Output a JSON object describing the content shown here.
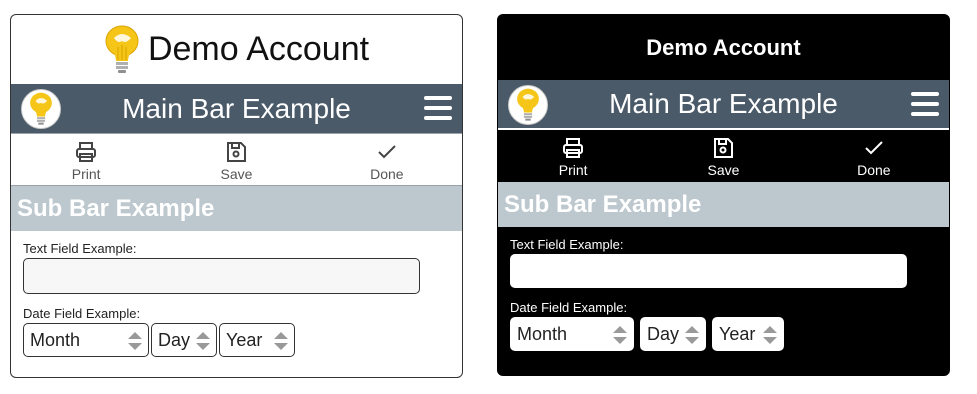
{
  "colors": {
    "mainbar": "#4a5a69",
    "subbar": "#bcc7ce",
    "bulb": "#f5c518",
    "dark_background": "#000000"
  },
  "panels": [
    {
      "theme": "light",
      "header_title": "Demo Account",
      "mainbar_title": "Main Bar Example",
      "toolbar": [
        {
          "label": "Print",
          "icon": "printer-icon"
        },
        {
          "label": "Save",
          "icon": "floppy-disk-icon"
        },
        {
          "label": "Done",
          "icon": "checkmark-icon"
        }
      ],
      "subbar_title": "Sub Bar Example",
      "text_field": {
        "label": "Text Field Example:",
        "value": ""
      },
      "date_field": {
        "label": "Date Field Example:",
        "month": "Month",
        "day": "Day",
        "year": "Year"
      }
    },
    {
      "theme": "dark",
      "header_title": "Demo Account",
      "mainbar_title": "Main Bar Example",
      "toolbar": [
        {
          "label": "Print",
          "icon": "printer-icon"
        },
        {
          "label": "Save",
          "icon": "floppy-disk-icon"
        },
        {
          "label": "Done",
          "icon": "checkmark-icon"
        }
      ],
      "subbar_title": "Sub Bar Example",
      "text_field": {
        "label": "Text Field Example:",
        "value": ""
      },
      "date_field": {
        "label": "Date Field Example:",
        "month": "Month",
        "day": "Day",
        "year": "Year"
      }
    }
  ]
}
